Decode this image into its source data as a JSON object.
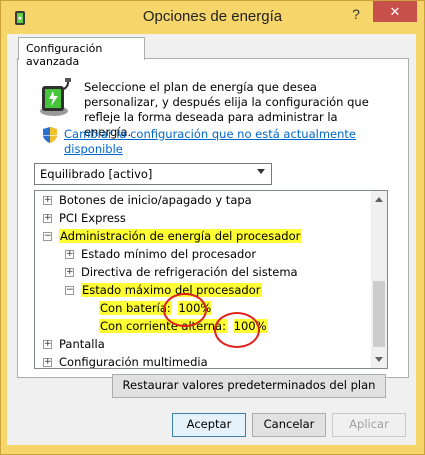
{
  "window": {
    "title": "Opciones de energía",
    "help_label": "?",
    "close_label": "✕"
  },
  "tab": {
    "label": "Configuración avanzada"
  },
  "description": "Seleccione el plan de energía que desea personalizar, y después elija la configuración que refleje la forma deseada para administrar la energía.",
  "link": {
    "text": "Cambiar la configuración que no está actualmente disponible"
  },
  "plan_select": {
    "value": "Equilibrado [activo]"
  },
  "tree": {
    "items": [
      {
        "label": "Botones de inicio/apagado y tapa",
        "expander": "+"
      },
      {
        "label": "PCI Express",
        "expander": "+"
      },
      {
        "label": "Administración de energía del procesador",
        "expander": "−"
      },
      {
        "label": "Estado mínimo del procesador",
        "expander": "+"
      },
      {
        "label": "Directiva de refrigeración del sistema",
        "expander": "+"
      },
      {
        "label": "Estado máximo del procesador",
        "expander": "−"
      },
      {
        "label": "Con batería:",
        "value": "100%"
      },
      {
        "label": "Con corriente alterna:",
        "value": "100%"
      },
      {
        "label": "Pantalla",
        "expander": "+"
      },
      {
        "label": "Configuración multimedia",
        "expander": "+"
      }
    ]
  },
  "buttons": {
    "restore": "Restaurar valores predeterminados del plan",
    "accept": "Aceptar",
    "cancel": "Cancelar",
    "apply": "Aplicar"
  },
  "colors": {
    "titlebar": "#f6d56a",
    "highlight": "#ffff33",
    "annotation": "#e0201a",
    "link": "#0066cc",
    "close": "#c7504b"
  }
}
